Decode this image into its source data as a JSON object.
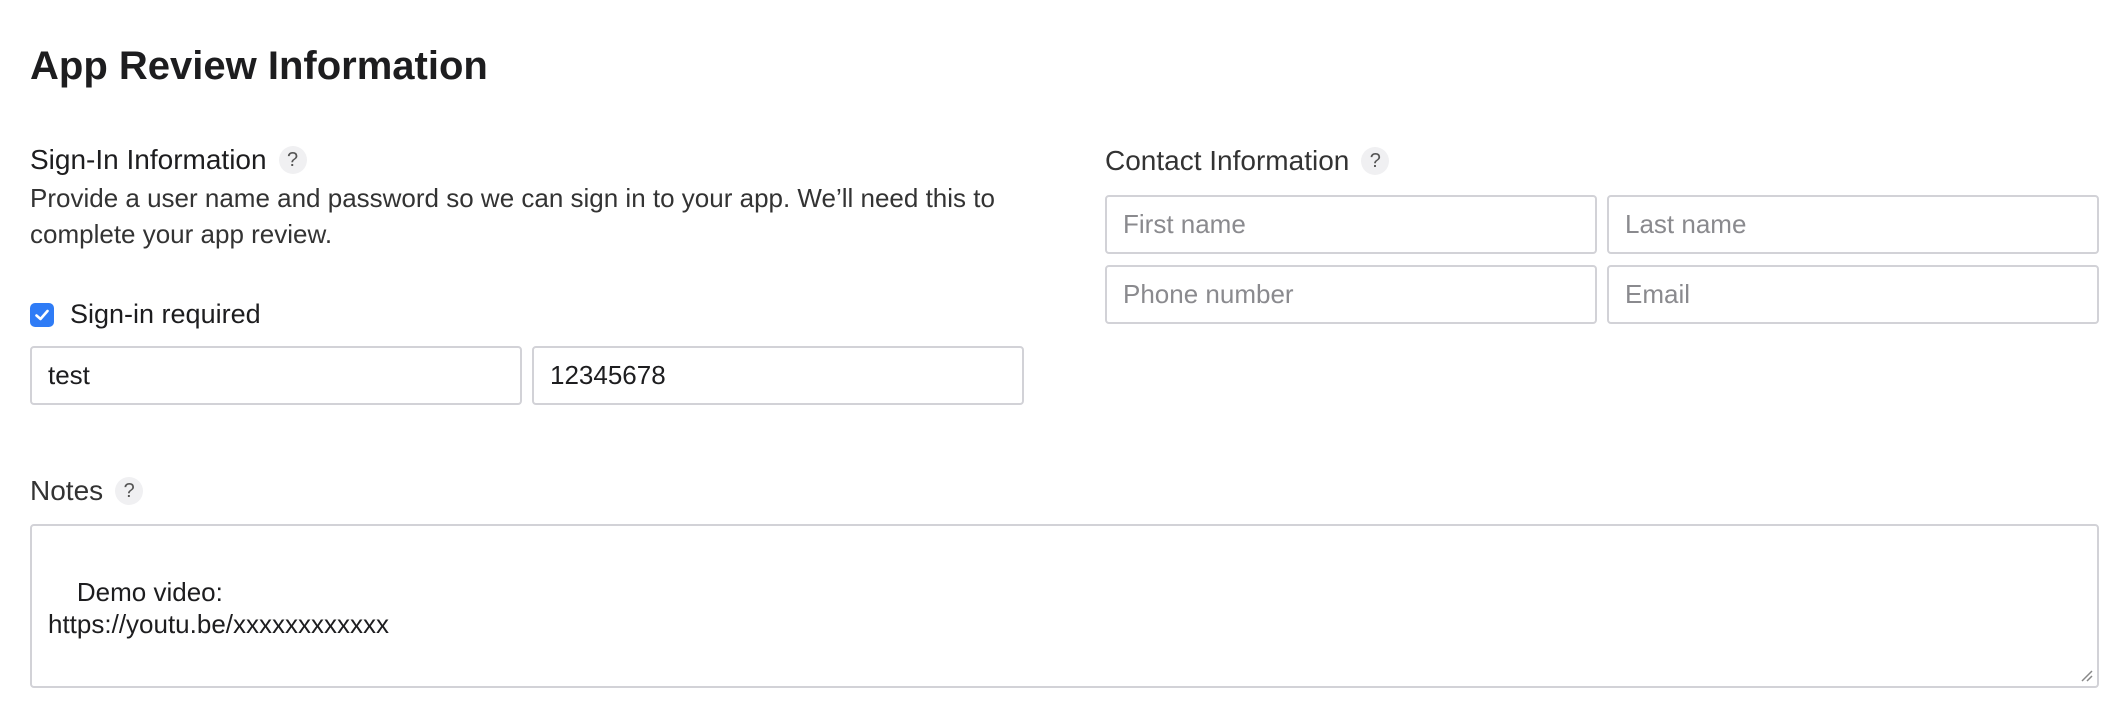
{
  "page": {
    "title": "App Review Information"
  },
  "signin": {
    "title": "Sign-In Information",
    "help": "?",
    "description": "Provide a user name and password so we can sign in to your app. We’ll need this to complete your app review.",
    "required_label": "Sign-in required",
    "required_checked": true,
    "username_value": "test",
    "password_value": "12345678"
  },
  "contact": {
    "title": "Contact Information",
    "help": "?",
    "first_name_placeholder": "First name",
    "last_name_placeholder": "Last name",
    "phone_placeholder": "Phone number",
    "email_placeholder": "Email"
  },
  "notes": {
    "title": "Notes",
    "help": "?",
    "value": "Demo video:\nhttps://youtu.be/xxxxxxxxxxxx"
  },
  "colors": {
    "accent": "#2f7cf6",
    "border": "#d2d2d7",
    "text": "#1d1d1f",
    "placeholder": "#8a8a8e"
  },
  "icons": {
    "help": "question-mark-icon",
    "checkbox": "checkmark-icon",
    "resize": "resize-handle-icon"
  }
}
